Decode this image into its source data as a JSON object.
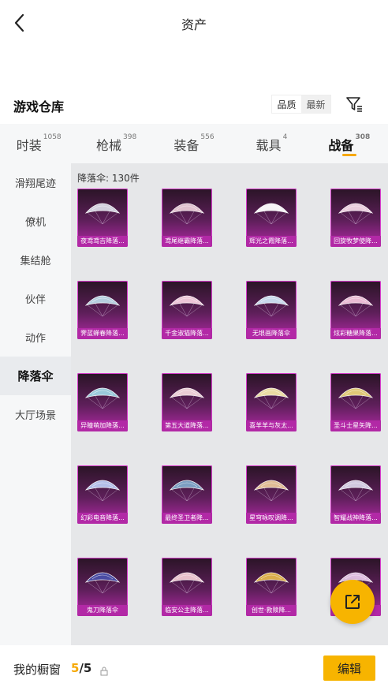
{
  "header": {
    "title": "资产"
  },
  "warehouse": {
    "title": "游戏仓库",
    "sort_quality": "品质",
    "sort_newest": "最新"
  },
  "category_tabs": [
    {
      "label": "时装",
      "count": "1058"
    },
    {
      "label": "枪械",
      "count": "398"
    },
    {
      "label": "装备",
      "count": "556"
    },
    {
      "label": "载具",
      "count": "4"
    },
    {
      "label": "战备",
      "count": "308"
    }
  ],
  "subnav": [
    {
      "label": "滑翔尾迹"
    },
    {
      "label": "僚机"
    },
    {
      "label": "集结舱"
    },
    {
      "label": "伙伴"
    },
    {
      "label": "动作"
    },
    {
      "label": "降落伞"
    },
    {
      "label": "大厅场景"
    }
  ],
  "content": {
    "heading": "降落伞: 130件",
    "items": [
      {
        "label": "夜鸢鸢吉降落...",
        "icon": "parachute-icon",
        "tint": "#d9d9e6"
      },
      {
        "label": "鸢尾继霸降落...",
        "icon": "parachute-icon",
        "tint": "#e8c9d6"
      },
      {
        "label": "辉光之霞降落...",
        "icon": "parachute-icon",
        "tint": "#ffffff"
      },
      {
        "label": "回旋牧梦使降...",
        "icon": "parachute-icon",
        "tint": "#f3d7e6"
      },
      {
        "label": "霁蓝蝉春降落...",
        "icon": "parachute-icon",
        "tint": "#bcd9e8"
      },
      {
        "label": "千金淑猫降落...",
        "icon": "parachute-icon",
        "tint": "#f6cfe0"
      },
      {
        "label": "无垠画降落伞",
        "icon": "parachute-icon",
        "tint": "#cfe3f5"
      },
      {
        "label": "炫彩糖果降落...",
        "icon": "parachute-icon",
        "tint": "#f3c4dc"
      },
      {
        "label": "异瞳萌加降落...",
        "icon": "parachute-icon",
        "tint": "#9fd3e3"
      },
      {
        "label": "第五大道降落...",
        "icon": "parachute-icon",
        "tint": "#f2d6dc"
      },
      {
        "label": "喜羊羊与灰太...",
        "icon": "parachute-icon",
        "tint": "#f3e6a8"
      },
      {
        "label": "圣斗士星矢降...",
        "icon": "parachute-icon",
        "tint": "#e8d27a"
      },
      {
        "label": "幻彩电音降落...",
        "icon": "parachute-icon",
        "tint": "#b9c7f0"
      },
      {
        "label": "最终圣卫者降...",
        "icon": "parachute-icon",
        "tint": "#7fa6c9"
      },
      {
        "label": "星穹咏叹调降...",
        "icon": "parachute-icon",
        "tint": "#e8c59a"
      },
      {
        "label": "智耀战神降落...",
        "icon": "parachute-icon",
        "tint": "#d9d2e8"
      },
      {
        "label": "鬼刀降落伞",
        "icon": "parachute-icon",
        "tint": "#4a4fa8"
      },
      {
        "label": "临安公主降落...",
        "icon": "parachute-icon",
        "tint": "#f1c9d3"
      },
      {
        "label": "创世·救赎降...",
        "icon": "parachute-icon",
        "tint": "#e2b64c"
      },
      {
        "label": "",
        "icon": "parachute-icon",
        "tint": "#e6c6e8"
      }
    ]
  },
  "bottom": {
    "showcase_label": "我的橱窗",
    "count_current": "5",
    "count_total": "/5",
    "edit_label": "编辑"
  },
  "colors": {
    "accent": "#f7b400",
    "rarity_purple": "#b229a6"
  }
}
